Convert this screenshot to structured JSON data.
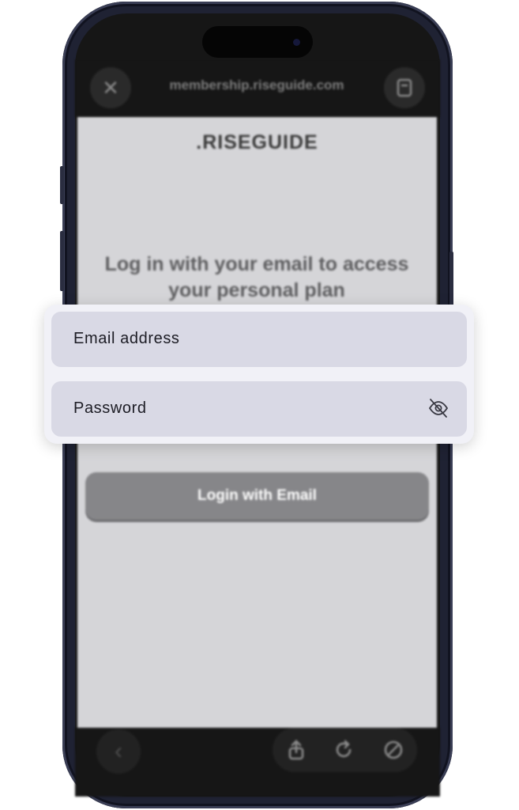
{
  "browser": {
    "url": "membership.riseguide.com",
    "close_icon": "close-icon",
    "reader_icon": "reader-icon"
  },
  "page": {
    "logo": ".RISEGUIDE",
    "heading": "Log in with your email to access your personal plan",
    "login_button": "Login with Email"
  },
  "form": {
    "email_placeholder": "Email address",
    "password_placeholder": "Password",
    "password_toggle_icon": "eye-off-icon"
  },
  "toolbar": {
    "back_icon": "chevron-left-icon",
    "share_icon": "share-icon",
    "reload_icon": "reload-icon",
    "block_icon": "block-icon"
  },
  "colors": {
    "phone_frame": "#1f2233",
    "screen_background": "#d5d5d8",
    "card_background": "#f1f1f7",
    "field_background": "#d9d9e5",
    "button_background": "#868689"
  }
}
